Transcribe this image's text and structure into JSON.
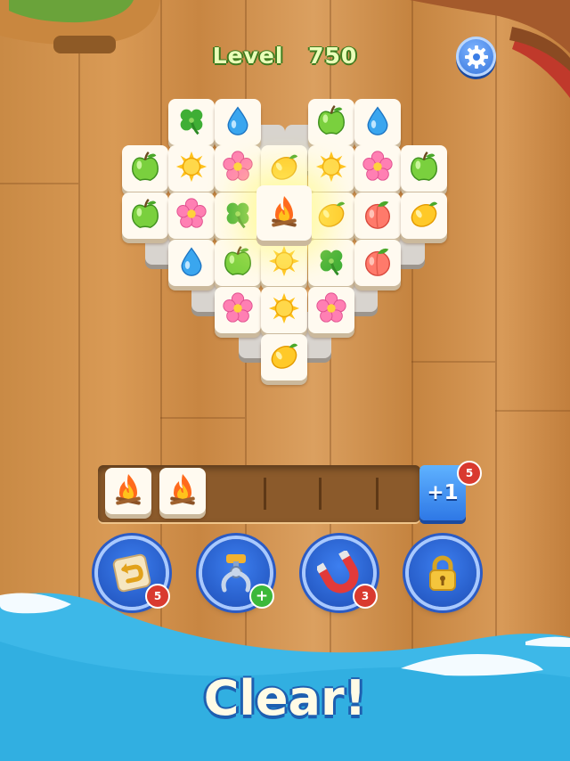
{
  "header": {
    "level_label": "Level",
    "level_number": "750"
  },
  "icons": {
    "settings": "gear-icon",
    "clover": "clover-icon",
    "drop": "water-drop-icon",
    "apple": "apple-icon",
    "sun": "sun-icon",
    "flower": "flower-icon",
    "lemon": "lemon-icon",
    "peach": "peach-icon",
    "fire": "campfire-icon"
  },
  "board": {
    "rows": [
      [
        "clover",
        "drop",
        "",
        "",
        "apple",
        "drop",
        ""
      ],
      [
        "apple",
        "sun",
        "flower",
        "lemon",
        "sun",
        "flower",
        "apple"
      ],
      [
        "apple",
        "flower",
        "clover",
        "fire",
        "lemon",
        "peach",
        "lemon"
      ],
      [
        "",
        "drop",
        "apple",
        "sun",
        "clover",
        "peach",
        ""
      ],
      [
        "",
        "",
        "flower",
        "sun",
        "flower",
        "",
        ""
      ],
      [
        "",
        "",
        "",
        "lemon",
        "",
        "",
        ""
      ]
    ]
  },
  "tray": {
    "tiles": [
      "fire",
      "fire"
    ],
    "capacity": 7,
    "add_slot_label": "+1",
    "add_slot_count": "5"
  },
  "powerups": [
    {
      "name": "undo",
      "icon": "undo-tile-icon",
      "count": "5"
    },
    {
      "name": "grab",
      "icon": "claw-icon",
      "count": "+"
    },
    {
      "name": "magnet",
      "icon": "magnet-icon",
      "count": "3"
    },
    {
      "name": "locked",
      "icon": "padlock-icon",
      "count": ""
    }
  ],
  "footer": {
    "message": "Clear!"
  },
  "colors": {
    "wood": "#d3954f",
    "water": "#37b9e6",
    "accent_blue": "#2e78e6",
    "badge_red": "#d93a2f"
  }
}
